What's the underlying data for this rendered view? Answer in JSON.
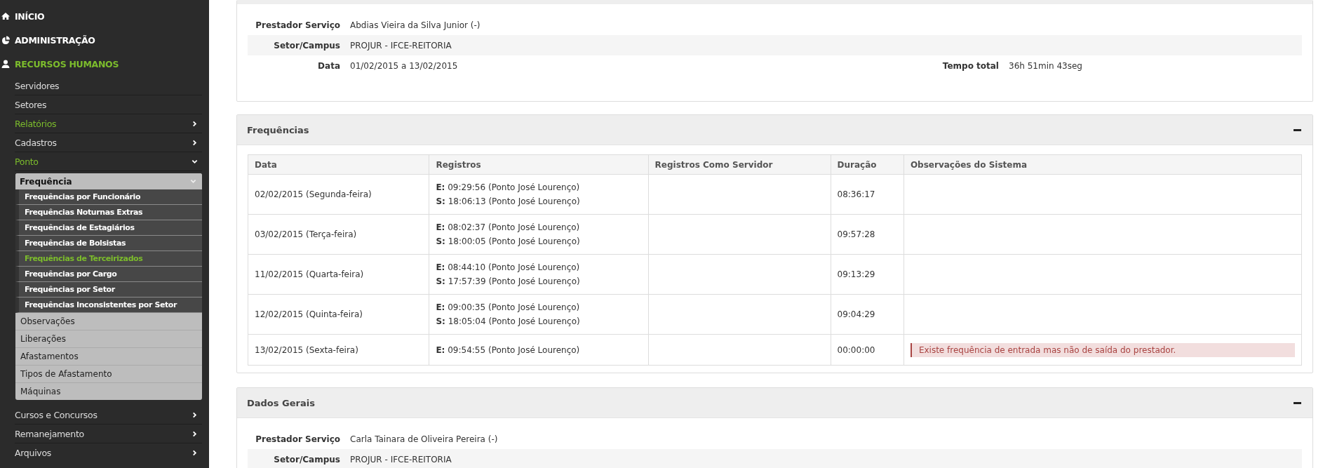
{
  "sidebar": {
    "items": [
      {
        "label": "INÍCIO",
        "kind": "home",
        "selected": false
      },
      {
        "label": "ADMINISTRAÇÃO",
        "kind": "admin",
        "selected": false
      },
      {
        "label": "RECURSOS HUMANOS",
        "kind": "people",
        "selected": true,
        "children": [
          {
            "label": "Servidores",
            "selected": false
          },
          {
            "label": "Setores",
            "selected": false
          },
          {
            "label": "Relatórios",
            "selected": true,
            "expanded": false
          },
          {
            "label": "Cadastros",
            "selected": false,
            "expanded": false
          },
          {
            "label": "Ponto",
            "selected": true,
            "expanded": true,
            "children": [
              {
                "label": "Frequência",
                "expanded": true,
                "children": [
                  {
                    "label": "Frequências por Funcionário",
                    "selected": false
                  },
                  {
                    "label": "Frequências Noturnas Extras",
                    "selected": false
                  },
                  {
                    "label": "Frequências de Estagiários",
                    "selected": false
                  },
                  {
                    "label": "Frequências de Bolsistas",
                    "selected": false
                  },
                  {
                    "label": "Frequências de Terceirizados",
                    "selected": true
                  },
                  {
                    "label": "Frequências por Cargo",
                    "selected": false
                  },
                  {
                    "label": "Frequências por Setor",
                    "selected": false
                  },
                  {
                    "label": "Frequências Inconsistentes por Setor",
                    "selected": false
                  }
                ]
              },
              {
                "label": "Observações"
              },
              {
                "label": "Liberações"
              },
              {
                "label": "Afastamentos"
              },
              {
                "label": "Tipos de Afastamento"
              },
              {
                "label": "Máquinas"
              }
            ]
          },
          {
            "label": "Cursos e Concursos",
            "selected": false,
            "expanded": false
          },
          {
            "label": "Remanejamento",
            "selected": false,
            "expanded": false
          },
          {
            "label": "Arquivos",
            "selected": false,
            "expanded": false
          }
        ]
      }
    ]
  },
  "summary": {
    "rows": [
      {
        "fields": [
          {
            "label": "Prestador Serviço",
            "value": "Abdias Vieira da Silva Junior (-)"
          }
        ]
      },
      {
        "fields": [
          {
            "label": "Setor/Campus",
            "value": "PROJUR - IFCE-REITORIA"
          }
        ]
      },
      {
        "fields": [
          {
            "label": "Data",
            "value": "01/02/2015 a 13/02/2015"
          },
          {
            "label": "Tempo total",
            "value": "36h 51min 43seg"
          }
        ]
      }
    ]
  },
  "frequencias": {
    "title": "Frequências",
    "table": {
      "columns": [
        "Data",
        "Registros",
        "Registros Como Servidor",
        "Duração",
        "Observações do Sistema"
      ],
      "rows": [
        {
          "data": "02/02/2015 (Segunda-feira)",
          "registros": [
            "**E:** 09:29:56 (Ponto José Lourenço)",
            "**S:** 18:06:13 (Ponto José Lourenço)"
          ],
          "duracao": "08:36:17"
        },
        {
          "data": "03/02/2015 (Terça-feira)",
          "registros": [
            "**E:** 08:02:37 (Ponto José Lourenço)",
            "**S:** 18:00:05 (Ponto José Lourenço)"
          ],
          "duracao": "09:57:28"
        },
        {
          "data": "11/02/2015 (Quarta-feira)",
          "registros": [
            "**E:** 08:44:10 (Ponto José Lourenço)",
            "**S:** 17:57:39 (Ponto José Lourenço)"
          ],
          "duracao": "09:13:29"
        },
        {
          "data": "12/02/2015 (Quinta-feira)",
          "registros": [
            "**E:** 09:00:35 (Ponto José Lourenço)",
            "**S:** 18:05:04 (Ponto José Lourenço)"
          ],
          "duracao": "09:04:29"
        },
        {
          "data": "13/02/2015 (Sexta-feira)",
          "registros": [
            "**E:** 09:54:55 (Ponto José Lourenço)"
          ],
          "duracao": "00:00:00",
          "observacao": "Existe frequência de entrada mas não de saída do prestador."
        }
      ]
    }
  },
  "dados_gerais": {
    "title": "Dados Gerais",
    "rows": [
      {
        "fields": [
          {
            "label": "Prestador Serviço",
            "value": "Carla Tainara de Oliveira Pereira (-)"
          }
        ]
      },
      {
        "fields": [
          {
            "label": "Setor/Campus",
            "value": "PROJUR - IFCE-REITORIA"
          }
        ]
      }
    ]
  }
}
